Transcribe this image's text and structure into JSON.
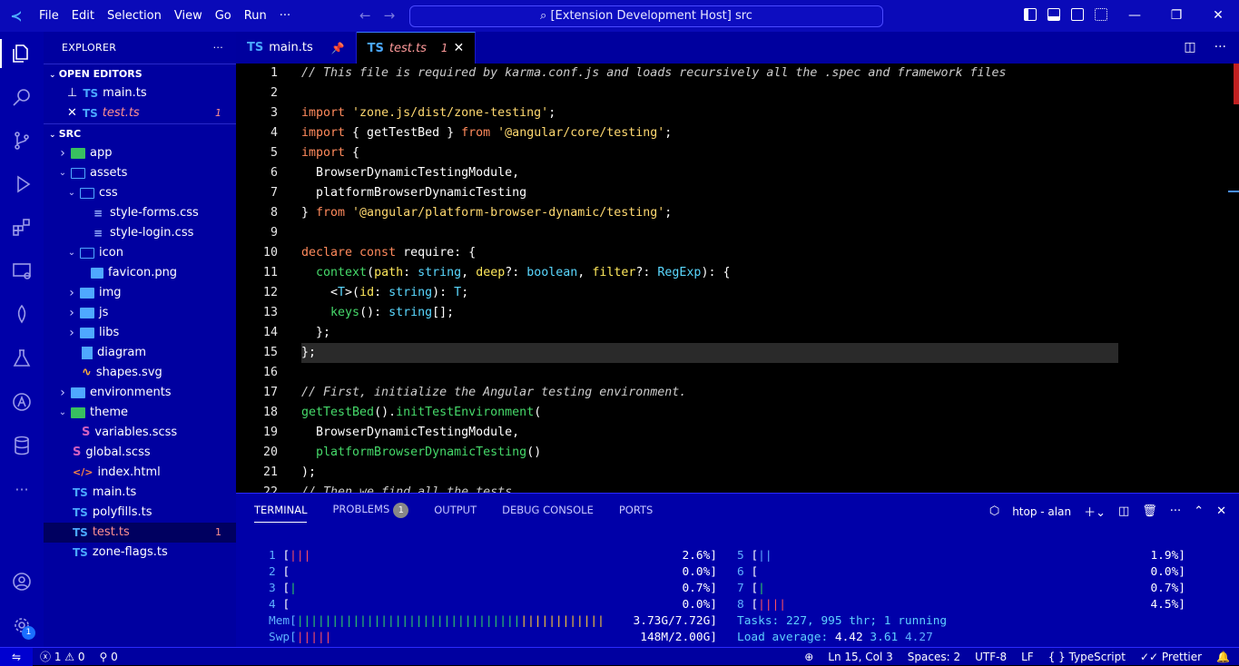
{
  "titlebar": {
    "menu": [
      "File",
      "Edit",
      "Selection",
      "View",
      "Go",
      "Run",
      "···"
    ],
    "search_text": "[Extension Development Host] src"
  },
  "sidebar": {
    "title": "EXPLORER",
    "more": "···",
    "open_editors_header": "OPEN EDITORS",
    "open_editors": [
      {
        "name": "main.ts",
        "marker": "pin",
        "errors": ""
      },
      {
        "name": "test.ts",
        "marker": "close",
        "errors": "1"
      }
    ],
    "folder_header": "SRC",
    "tree": [
      {
        "name": "app",
        "depth": 1,
        "kind": "folder-green",
        "expanded": false
      },
      {
        "name": "assets",
        "depth": 1,
        "kind": "folder",
        "expanded": true
      },
      {
        "name": "css",
        "depth": 2,
        "kind": "folder",
        "expanded": true
      },
      {
        "name": "style-forms.css",
        "depth": 3,
        "kind": "css"
      },
      {
        "name": "style-login.css",
        "depth": 3,
        "kind": "css"
      },
      {
        "name": "icon",
        "depth": 2,
        "kind": "folder",
        "expanded": true
      },
      {
        "name": "favicon.png",
        "depth": 3,
        "kind": "image"
      },
      {
        "name": "img",
        "depth": 2,
        "kind": "folder-img",
        "expanded": false
      },
      {
        "name": "js",
        "depth": 2,
        "kind": "folder",
        "expanded": false
      },
      {
        "name": "libs",
        "depth": 2,
        "kind": "folder",
        "expanded": false
      },
      {
        "name": "diagram",
        "depth": 2,
        "kind": "file"
      },
      {
        "name": "shapes.svg",
        "depth": 2,
        "kind": "svg"
      },
      {
        "name": "environments",
        "depth": 1,
        "kind": "folder",
        "expanded": false
      },
      {
        "name": "theme",
        "depth": 1,
        "kind": "folder-green",
        "expanded": true
      },
      {
        "name": "variables.scss",
        "depth": 2,
        "kind": "scss"
      },
      {
        "name": "global.scss",
        "depth": 1,
        "kind": "scss"
      },
      {
        "name": "index.html",
        "depth": 1,
        "kind": "html"
      },
      {
        "name": "main.ts",
        "depth": 1,
        "kind": "ts"
      },
      {
        "name": "polyfills.ts",
        "depth": 1,
        "kind": "ts"
      },
      {
        "name": "test.ts",
        "depth": 1,
        "kind": "ts",
        "errors": "1",
        "selected": true
      },
      {
        "name": "zone-flags.ts",
        "depth": 1,
        "kind": "ts"
      }
    ]
  },
  "tabs": [
    {
      "icon": "TS",
      "name": "main.ts",
      "pinned": true
    },
    {
      "icon": "TS",
      "name": "test.ts",
      "dirty_count": "1",
      "active": true
    }
  ],
  "code": [
    {
      "n": "1",
      "parts": [
        [
          "cm",
          "// This file is required by karma.conf.js and loads recursively all the .spec and framework files"
        ]
      ]
    },
    {
      "n": "2",
      "parts": [
        [
          "pl",
          ""
        ]
      ]
    },
    {
      "n": "3",
      "parts": [
        [
          "kw",
          "import "
        ],
        [
          "st",
          "'zone.js/dist/zone-testing'"
        ],
        [
          "pl",
          ";"
        ]
      ]
    },
    {
      "n": "4",
      "parts": [
        [
          "kw",
          "import "
        ],
        [
          "pl",
          "{ getTestBed } "
        ],
        [
          "kw",
          "from "
        ],
        [
          "st",
          "'@angular/core/testing'"
        ],
        [
          "pl",
          ";"
        ]
      ]
    },
    {
      "n": "5",
      "parts": [
        [
          "kw",
          "import "
        ],
        [
          "pl",
          "{"
        ]
      ]
    },
    {
      "n": "6",
      "parts": [
        [
          "pl",
          "  BrowserDynamicTestingModule,"
        ]
      ]
    },
    {
      "n": "7",
      "parts": [
        [
          "pl",
          "  platformBrowserDynamicTesting"
        ]
      ]
    },
    {
      "n": "8",
      "parts": [
        [
          "pl",
          "} "
        ],
        [
          "kw",
          "from "
        ],
        [
          "st",
          "'@angular/platform-browser-dynamic/testing'"
        ],
        [
          "pl",
          ";"
        ]
      ]
    },
    {
      "n": "9",
      "parts": [
        [
          "pl",
          ""
        ]
      ]
    },
    {
      "n": "10",
      "parts": [
        [
          "kw",
          "declare const "
        ],
        [
          "pl",
          "require: {"
        ]
      ]
    },
    {
      "n": "11",
      "parts": [
        [
          "pl",
          "  "
        ],
        [
          "fn",
          "context"
        ],
        [
          "pl",
          "("
        ],
        [
          "pm",
          "path"
        ],
        [
          "pl",
          ": "
        ],
        [
          "ty",
          "string"
        ],
        [
          "pl",
          ", "
        ],
        [
          "pm",
          "deep"
        ],
        [
          "pl",
          "?: "
        ],
        [
          "ty",
          "boolean"
        ],
        [
          "pl",
          ", "
        ],
        [
          "pm",
          "filter"
        ],
        [
          "pl",
          "?: "
        ],
        [
          "ty",
          "RegExp"
        ],
        [
          "pl",
          "): {"
        ]
      ]
    },
    {
      "n": "12",
      "parts": [
        [
          "pl",
          "    <"
        ],
        [
          "ty",
          "T"
        ],
        [
          "pl",
          ">("
        ],
        [
          "pm",
          "id"
        ],
        [
          "pl",
          ": "
        ],
        [
          "ty",
          "string"
        ],
        [
          "pl",
          "): "
        ],
        [
          "ty",
          "T"
        ],
        [
          "pl",
          ";"
        ]
      ]
    },
    {
      "n": "13",
      "parts": [
        [
          "pl",
          "    "
        ],
        [
          "fn",
          "keys"
        ],
        [
          "pl",
          "(): "
        ],
        [
          "ty",
          "string"
        ],
        [
          "pl",
          "[];"
        ]
      ]
    },
    {
      "n": "14",
      "parts": [
        [
          "pl",
          "  };"
        ]
      ]
    },
    {
      "n": "15",
      "parts": [
        [
          "pl",
          "};"
        ]
      ],
      "current": true
    },
    {
      "n": "16",
      "parts": [
        [
          "pl",
          ""
        ]
      ]
    },
    {
      "n": "17",
      "parts": [
        [
          "cm",
          "// First, initialize the Angular testing environment."
        ]
      ]
    },
    {
      "n": "18",
      "parts": [
        [
          "fn",
          "getTestBed"
        ],
        [
          "pl",
          "()."
        ],
        [
          "fn",
          "initTestEnvironment"
        ],
        [
          "pl",
          "("
        ]
      ]
    },
    {
      "n": "19",
      "parts": [
        [
          "pl",
          "  BrowserDynamicTestingModule,"
        ]
      ]
    },
    {
      "n": "20",
      "parts": [
        [
          "pl",
          "  "
        ],
        [
          "fn",
          "platformBrowserDynamicTesting"
        ],
        [
          "pl",
          "()"
        ]
      ]
    },
    {
      "n": "21",
      "parts": [
        [
          "pl",
          ");"
        ]
      ]
    },
    {
      "n": "22",
      "parts": [
        [
          "cm",
          "// Then we find all the tests."
        ]
      ]
    }
  ],
  "panel": {
    "tabs": [
      "TERMINAL",
      "PROBLEMS",
      "OUTPUT",
      "DEBUG CONSOLE",
      "PORTS"
    ],
    "problems_count": "1",
    "terminal_name": "htop - alan"
  },
  "htop": {
    "cpus_left": [
      {
        "n": "1",
        "bar": "|||",
        "bar_color": "r",
        "pct": "2.6%]"
      },
      {
        "n": "2",
        "bar": "",
        "bar_color": "r",
        "pct": "0.0%]"
      },
      {
        "n": "3",
        "bar": "|",
        "bar_color": "g",
        "pct": "0.7%]"
      },
      {
        "n": "4",
        "bar": "",
        "bar_color": "r",
        "pct": "0.0%]"
      }
    ],
    "cpus_right": [
      {
        "n": "5",
        "bar": "||",
        "bar_color": "b",
        "pct": "1.9%]"
      },
      {
        "n": "6",
        "bar": "",
        "bar_color": "r",
        "pct": "0.0%]"
      },
      {
        "n": "7",
        "bar": "|",
        "bar_color": "g",
        "pct": "0.7%]"
      },
      {
        "n": "8",
        "bar": "||||",
        "bar_color": "r",
        "pct": "4.5%]"
      }
    ],
    "mem_label": "Mem[",
    "mem_bar_g": "||||||||||||||||||||||||||||||||",
    "mem_bar_y": "||||||||||||",
    "mem_val": "3.73G/7.72G]",
    "swp_label": "Swp[",
    "swp_bar": "|||||",
    "swp_val": "148M/2.00G]",
    "tasks_label": "Tasks: ",
    "tasks_val": "227, 995 thr; 1 running",
    "load_label": "Load average: ",
    "load_1": "4.42",
    "load_5": "3.61",
    "load_15": "4.27"
  },
  "status": {
    "errors": "1",
    "warnings": "0",
    "ports": "0",
    "position": "Ln 15, Col 3",
    "spaces": "Spaces: 2",
    "encoding": "UTF-8",
    "eol": "LF",
    "language": "TypeScript",
    "formatter": "Prettier"
  }
}
